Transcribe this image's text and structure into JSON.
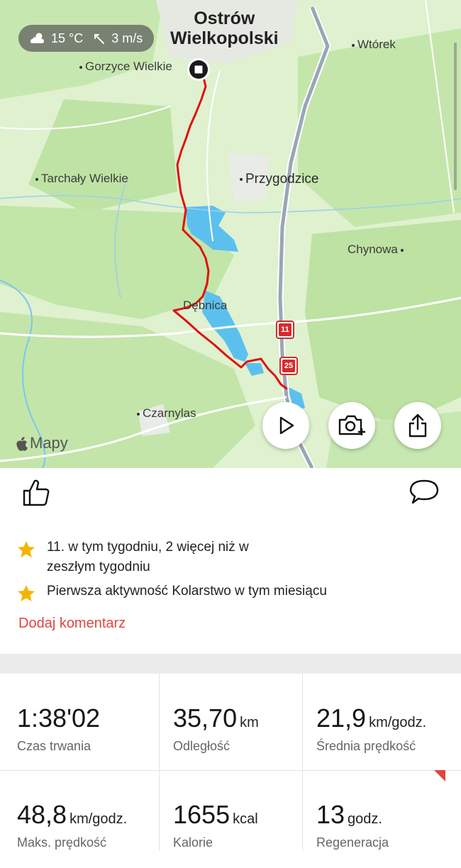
{
  "map": {
    "weather": {
      "temperature": "15 °C",
      "wind": "3 m/s",
      "icon": "partly-cloudy-icon"
    },
    "city": {
      "line1": "Ostrów",
      "line2": "Wielkopolski"
    },
    "places": {
      "gorzyce": "Gorzyce Wielkie",
      "wtorek": "Wtórek",
      "tarchaly": "Tarchały Wielkie",
      "przygodzice": "Przygodzice",
      "chynowa": "Chynowa",
      "debnica": "Dębnica",
      "czarnylas": "Czarnylas"
    },
    "road_badges": {
      "a": "11",
      "b": "25"
    },
    "attribution": "Mapy",
    "route_color": "#e01010"
  },
  "actions": {
    "like_icon": "thumbs-up-icon",
    "comment_icon": "comment-bubble-icon"
  },
  "achievements": [
    {
      "text_line1": "11. w tym tygodniu, 2 więcej niż w",
      "text_line2": "zeszłym tygodniu"
    },
    {
      "text_line1": "Pierwsza aktywność Kolarstwo w tym miesiącu"
    }
  ],
  "add_comment": "Dodaj komentarz",
  "stats": [
    {
      "value": "1:38'02",
      "unit": "",
      "label": "Czas trwania"
    },
    {
      "value": "35,70",
      "unit": "km",
      "label": "Odległość"
    },
    {
      "value": "21,9",
      "unit": "km/godz.",
      "label": "Średnia prędkość"
    },
    {
      "value": "48,8",
      "unit": "km/godz.",
      "label": "Maks. prędkość"
    },
    {
      "value": "1655",
      "unit": "kcal",
      "label": "Kalorie"
    },
    {
      "value": "13",
      "unit": "godz.",
      "label": "Regeneracja"
    }
  ],
  "colors": {
    "accent": "#e0453f",
    "star": "#f5b400",
    "water": "#5cc0ee",
    "forest": "#bfe3a4"
  }
}
